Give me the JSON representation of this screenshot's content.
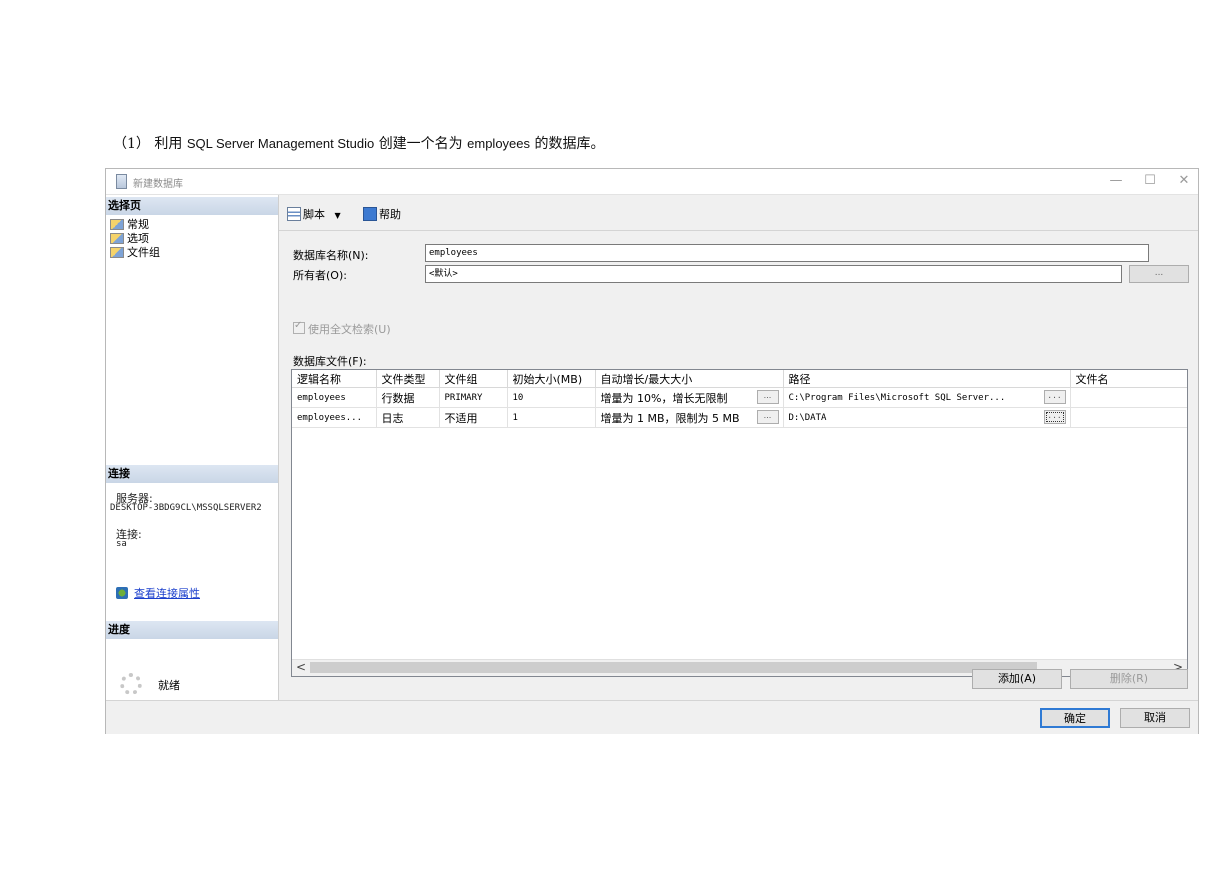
{
  "caption": {
    "number": "（1）",
    "pre": "利用",
    "app": "SQL Server Management Studio",
    "mid": "创建一个名为",
    "dbname": "employees",
    "post": "的数据库。"
  },
  "window": {
    "title": "新建数据库",
    "controls": {
      "minimize": "—",
      "maximize": "☐",
      "close": "✕"
    }
  },
  "sidebar": {
    "select_page_header": "选择页",
    "pages": [
      {
        "label": "常规"
      },
      {
        "label": "选项"
      },
      {
        "label": "文件组"
      }
    ],
    "connection_header": "连接",
    "server_label": "服务器:",
    "server_value": "DESKTOP-3BDG9CL\\MSSQLSERVER2",
    "connection_label": "连接:",
    "connection_value": "sa",
    "view_properties_link": "查看连接属性",
    "progress_header": "进度",
    "progress_status": "就绪"
  },
  "toolbar": {
    "script_label": "脚本",
    "dropdown_arrow": "▼",
    "help_label": "帮助"
  },
  "form": {
    "db_name_label": "数据库名称(N):",
    "db_name_value": "employees",
    "owner_label": "所有者(O):",
    "owner_value": "<默认>",
    "owner_browse": "...",
    "fulltext_label": "使用全文检索(U)",
    "files_label": "数据库文件(F):"
  },
  "table": {
    "columns": [
      "逻辑名称",
      "文件类型",
      "文件组",
      "初始大小(MB)",
      "自动增长/最大大小",
      "路径",
      "文件名"
    ],
    "rows": [
      {
        "logical": "employees",
        "type": "行数据",
        "group": "PRIMARY",
        "size": "10",
        "growth": "增量为 10%，增长无限制",
        "growth_btn": "...",
        "path": "C:\\Program Files\\Microsoft SQL Server...",
        "path_btn": "...",
        "filename": ""
      },
      {
        "logical": "employees...",
        "type": "日志",
        "group": "不适用",
        "size": "1",
        "growth": "增量为 1 MB，限制为 5 MB",
        "growth_btn": "...",
        "path": "D:\\DATA",
        "path_btn": "...",
        "filename": ""
      }
    ],
    "scroll_left": "<",
    "scroll_right": ">"
  },
  "buttons": {
    "add": "添加(A)",
    "remove": "删除(R)",
    "ok": "确定",
    "cancel": "取消"
  }
}
